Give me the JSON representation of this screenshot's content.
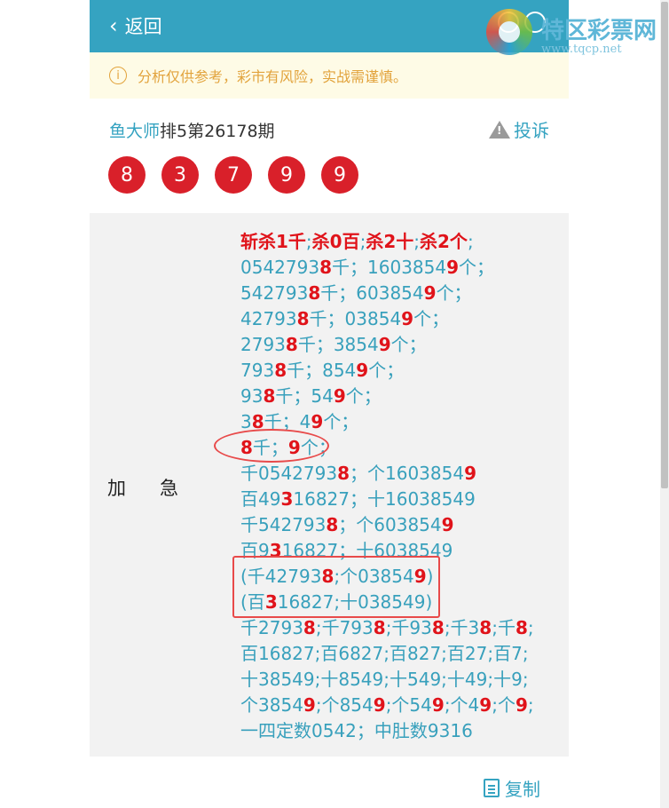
{
  "header": {
    "back_label": "返回"
  },
  "watermark": {
    "name": "特区彩票网",
    "url": "www.tqcp.net"
  },
  "notice": {
    "text": "分析仅供参考，彩市有风险，实战需谨慎。"
  },
  "title": {
    "author": "鱼大师",
    "issue": "排5第26178期"
  },
  "complain_label": "投诉",
  "balls": [
    "8",
    "3",
    "7",
    "9",
    "9"
  ],
  "panel": {
    "label": "加急"
  },
  "copy_label": "复制",
  "analysis_lines": [
    [
      {
        "t": "斩杀1千",
        "r": 1
      },
      {
        "t": ";"
      },
      {
        "t": "杀0百",
        "r": 1
      },
      {
        "t": ";"
      },
      {
        "t": "杀2十",
        "r": 1
      },
      {
        "t": ";"
      },
      {
        "t": "杀2个",
        "r": 1
      },
      {
        "t": ";"
      }
    ],
    [
      {
        "t": "054279"
      },
      {
        "t": "3",
        "r": 0
      },
      {
        "t": "8",
        "r": 1
      },
      {
        "t": "千；160385"
      },
      {
        "t": "4"
      },
      {
        "t": "9",
        "r": 1
      },
      {
        "t": "个；"
      }
    ],
    [
      {
        "t": "542793"
      },
      {
        "t": "8",
        "r": 1
      },
      {
        "t": "千；603854"
      },
      {
        "t": "9",
        "r": 1
      },
      {
        "t": "个；"
      }
    ],
    [
      {
        "t": "42793"
      },
      {
        "t": "8",
        "r": 1
      },
      {
        "t": "千；03854"
      },
      {
        "t": "9",
        "r": 1
      },
      {
        "t": "个；"
      }
    ],
    [
      {
        "t": "2793"
      },
      {
        "t": "8",
        "r": 1
      },
      {
        "t": "千；3854"
      },
      {
        "t": "9",
        "r": 1
      },
      {
        "t": "个；"
      }
    ],
    [
      {
        "t": "793"
      },
      {
        "t": "8",
        "r": 1
      },
      {
        "t": "千；854"
      },
      {
        "t": "9",
        "r": 1
      },
      {
        "t": "个；"
      }
    ],
    [
      {
        "t": "93"
      },
      {
        "t": "8",
        "r": 1
      },
      {
        "t": "千；54"
      },
      {
        "t": "9",
        "r": 1
      },
      {
        "t": "个；"
      }
    ],
    [
      {
        "t": "3"
      },
      {
        "t": "8",
        "r": 1
      },
      {
        "t": "千；4"
      },
      {
        "t": "9",
        "r": 1
      },
      {
        "t": "个；"
      }
    ],
    [
      {
        "t": "8",
        "r": 1
      },
      {
        "t": "千；"
      },
      {
        "t": "9",
        "r": 1
      },
      {
        "t": "个；"
      }
    ],
    [
      {
        "t": "千0542793"
      },
      {
        "t": "8",
        "r": 1
      },
      {
        "t": "；个1603854"
      },
      {
        "t": "9",
        "r": 1
      }
    ],
    [
      {
        "t": "百49"
      },
      {
        "t": "3",
        "r": 1
      },
      {
        "t": "16827；十16038549"
      }
    ],
    [
      {
        "t": "千542793"
      },
      {
        "t": "8",
        "r": 1
      },
      {
        "t": "；个603854"
      },
      {
        "t": "9",
        "r": 1
      }
    ],
    [
      {
        "t": "百9"
      },
      {
        "t": "3",
        "r": 1
      },
      {
        "t": "16827；十6038549"
      }
    ],
    [
      {
        "t": "(千42793"
      },
      {
        "t": "8",
        "r": 1
      },
      {
        "t": ";个03854"
      },
      {
        "t": "9",
        "r": 1
      },
      {
        "t": ")"
      }
    ],
    [
      {
        "t": "(百"
      },
      {
        "t": "3",
        "r": 1
      },
      {
        "t": "16827;十038549)"
      }
    ],
    [
      {
        "t": "千279"
      },
      {
        "t": "3"
      },
      {
        "t": "8",
        "r": 1
      },
      {
        "t": ";千79"
      },
      {
        "t": "3"
      },
      {
        "t": "8",
        "r": 1
      },
      {
        "t": ";千9"
      },
      {
        "t": "3"
      },
      {
        "t": "8",
        "r": 1
      },
      {
        "t": ";千3"
      },
      {
        "t": "8",
        "r": 1
      },
      {
        "t": ";千"
      },
      {
        "t": "8",
        "r": 1
      },
      {
        "t": ";"
      }
    ],
    [
      {
        "t": "百16827;百6827;百827;百27;百7;"
      }
    ],
    [
      {
        "t": "十38549;十8549;十549;十49;十9;"
      }
    ],
    [
      {
        "t": "个385"
      },
      {
        "t": "4"
      },
      {
        "t": "9",
        "r": 1
      },
      {
        "t": ";个85"
      },
      {
        "t": "4"
      },
      {
        "t": "9",
        "r": 1
      },
      {
        "t": ";个5"
      },
      {
        "t": "4"
      },
      {
        "t": "9",
        "r": 1
      },
      {
        "t": ";个4"
      },
      {
        "t": "9",
        "r": 1
      },
      {
        "t": ";个"
      },
      {
        "t": "9",
        "r": 1
      },
      {
        "t": ";"
      }
    ],
    [
      {
        "t": "一四定数0542；中肚数9316"
      }
    ]
  ]
}
